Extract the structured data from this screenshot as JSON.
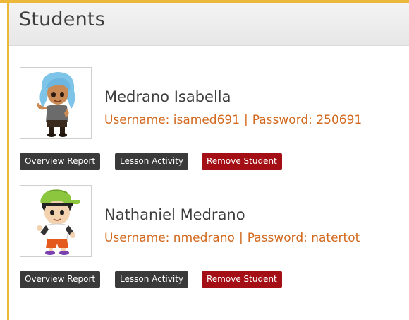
{
  "page": {
    "title": "Students",
    "accent_color": "#ecb83a",
    "danger_color": "#a30f14",
    "credential_color": "#d2691e"
  },
  "buttons": {
    "overview": "Overview Report",
    "lesson": "Lesson Activity",
    "remove": "Remove Student"
  },
  "students": [
    {
      "name": "Medrano Isabella",
      "username_label": "Username: isamed691",
      "separator": "|",
      "password_label": "Password: 250691",
      "avatar": "girl-avatar-blue-hair"
    },
    {
      "name": "Nathaniel Medrano",
      "username_label": "Username: nmedrano",
      "separator": "|",
      "password_label": "Password: natertot",
      "avatar": "boy-avatar-green-cap"
    }
  ]
}
